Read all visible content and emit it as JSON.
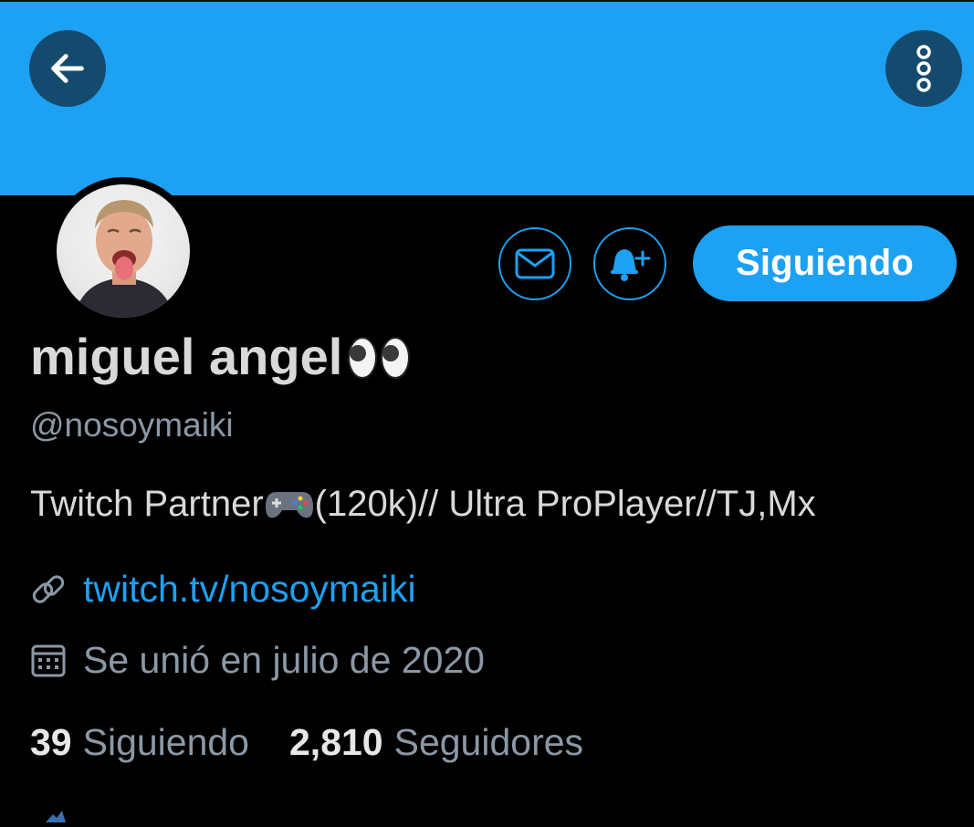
{
  "colors": {
    "accent": "#1da1f2",
    "background": "#000000",
    "muted": "#8b98a5",
    "text": "#d9d9d9"
  },
  "header": {
    "back_icon": "arrow-left-icon",
    "more_icon": "more-vertical-icon"
  },
  "actions": {
    "message_icon": "mail-icon",
    "notify_icon": "bell-plus-icon",
    "follow_label": "Siguiendo"
  },
  "profile": {
    "name": "miguel angel",
    "name_emoji": "eyes-icon",
    "handle": "@nosoymaiki",
    "bio_before": "Twitch Partner",
    "bio_emoji": "game-controller-icon",
    "bio_after": "(120k)// Ultra ProPlayer//TJ,Mx",
    "link": "twitch.tv/nosoymaiki",
    "joined": "Se unió en julio de 2020"
  },
  "stats": {
    "following_count": "39",
    "following_label": "Siguiendo",
    "followers_count": "2,810",
    "followers_label": "Seguidores"
  }
}
